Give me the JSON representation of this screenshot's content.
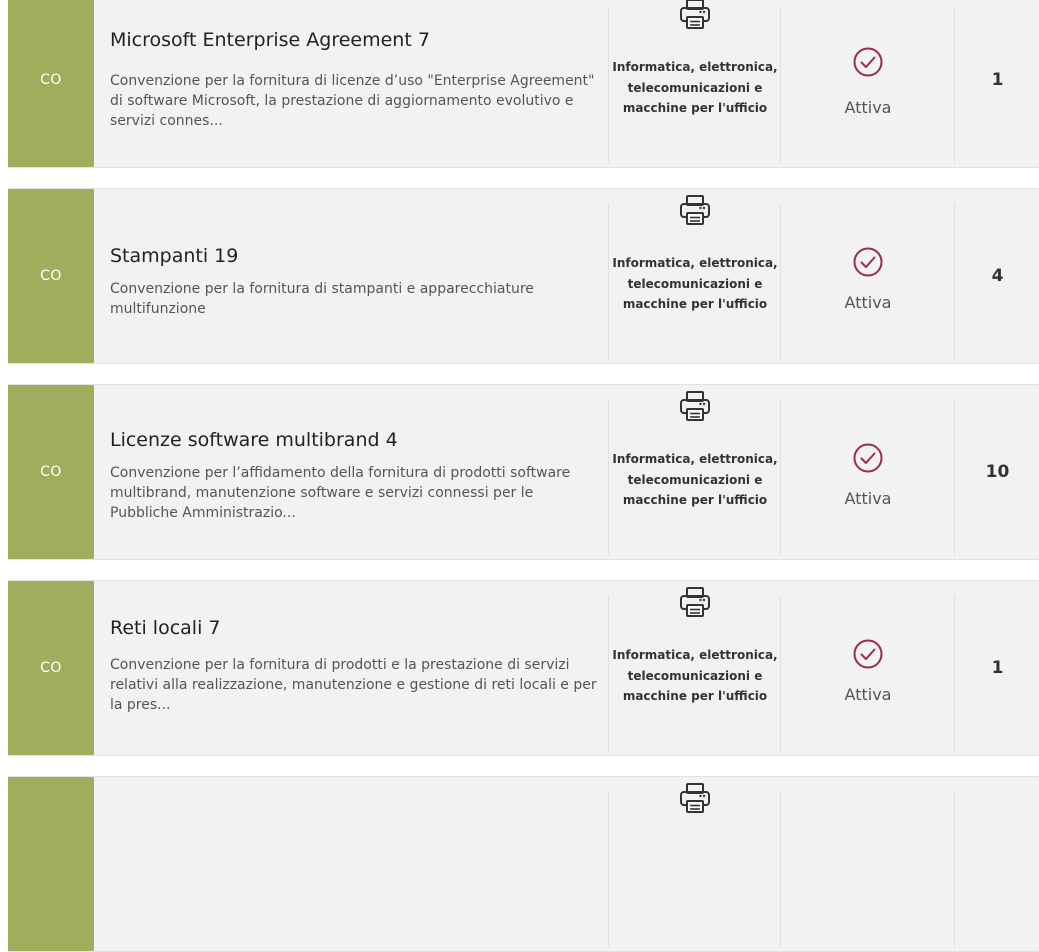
{
  "colors": {
    "badge": "#9eae5c",
    "check": "#9b2a55",
    "row_bg": "#f2f2f2"
  },
  "icons": {
    "category": "printer-icon",
    "status": "check-circle-icon"
  },
  "rows": [
    {
      "badge": "CO",
      "title": "Microsoft Enterprise Agreement 7",
      "description": "Convenzione per la fornitura di licenze d’uso \"Enterprise Agreement\" di software Microsoft, la prestazione di aggiornamento evolutivo e servizi connes...",
      "category": "Informatica, elettronica, telecomunicazioni e macchine per l'ufficio",
      "status": "Attiva",
      "count": "1"
    },
    {
      "badge": "CO",
      "title": "Stampanti 19",
      "description": "Convenzione per la fornitura di stampanti e apparecchiature multifunzione",
      "category": "Informatica, elettronica, telecomunicazioni e macchine per l'ufficio",
      "status": "Attiva",
      "count": "4"
    },
    {
      "badge": "CO",
      "title": "Licenze software multibrand 4",
      "description": "Convenzione per l’affidamento della fornitura di prodotti software multibrand, manutenzione software e servizi connessi per le Pubbliche Amministrazio...",
      "category": "Informatica, elettronica, telecomunicazioni e macchine per l'ufficio",
      "status": "Attiva",
      "count": "10"
    },
    {
      "badge": "CO",
      "title": "Reti locali 7",
      "description": "Convenzione per la fornitura di prodotti e la prestazione di servizi relativi alla realizzazione, manutenzione e gestione di reti locali e per la pres...",
      "category": "Informatica, elettronica, telecomunicazioni e macchine per l'ufficio",
      "status": "Attiva",
      "count": "1"
    },
    {
      "badge": "",
      "title": "",
      "description": "",
      "category": "",
      "status": "",
      "count": ""
    }
  ]
}
